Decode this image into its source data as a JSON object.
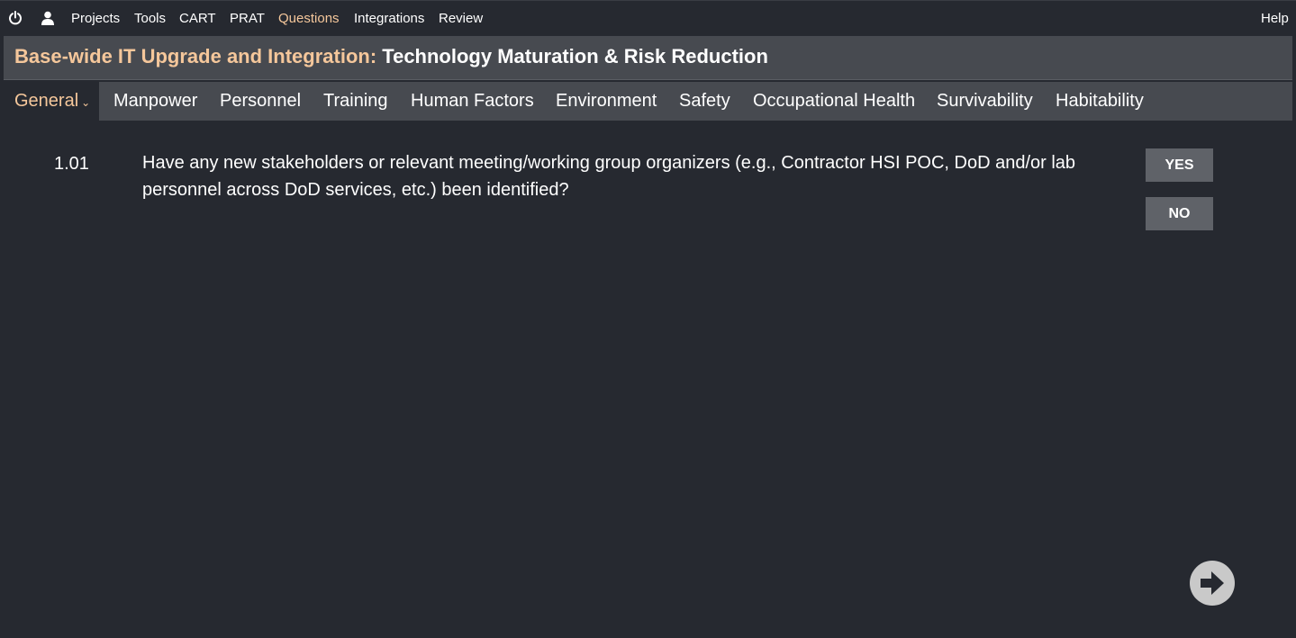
{
  "nav": {
    "icons": {
      "power": "power-icon",
      "user": "user-icon"
    },
    "items": [
      "Projects",
      "Tools",
      "CART",
      "PRAT",
      "Questions",
      "Integrations",
      "Review"
    ],
    "active_item": "Questions",
    "help": "Help"
  },
  "header": {
    "project": "Base-wide IT Upgrade and Integration:",
    "phase": "Technology Maturation & Risk Reduction"
  },
  "tabs": [
    "General",
    "Manpower",
    "Personnel",
    "Training",
    "Human Factors",
    "Environment",
    "Safety",
    "Occupational Health",
    "Survivability",
    "Habitability"
  ],
  "active_tab": "General",
  "question": {
    "number": "1.01",
    "text": "Have any new stakeholders or relevant meeting/working group organizers (e.g., Contractor HSI POC, DoD and/or lab personnel across DoD services, etc.) been identified?",
    "yes_label": "YES",
    "no_label": "NO"
  },
  "next_icon": "arrow-right-icon",
  "colors": {
    "background": "#262930",
    "panel": "#474a50",
    "accent": "#f5c79b",
    "button": "#5f6268",
    "next_button": "#c9c9c9"
  }
}
